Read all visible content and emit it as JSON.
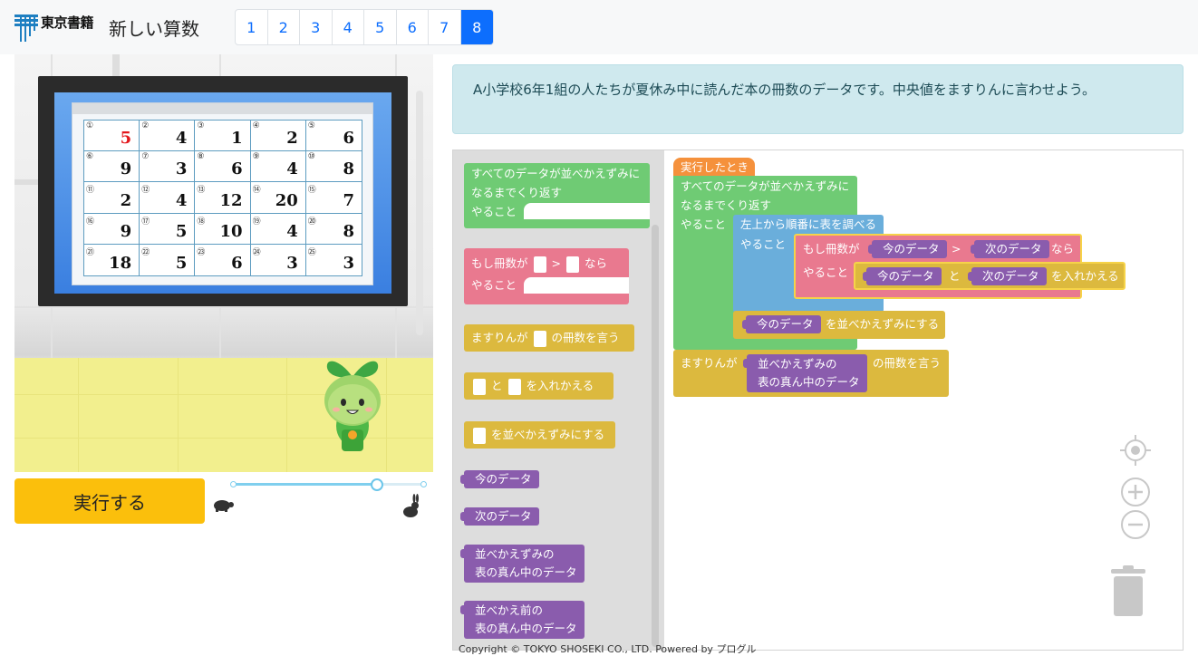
{
  "header": {
    "logo_text": "東京書籍",
    "title": "新しい算数",
    "pages": [
      "1",
      "2",
      "3",
      "4",
      "5",
      "6",
      "7",
      "8"
    ],
    "active_page": "8"
  },
  "board": {
    "cells": [
      {
        "i": "①",
        "v": "5",
        "red": true
      },
      {
        "i": "②",
        "v": "4"
      },
      {
        "i": "③",
        "v": "1"
      },
      {
        "i": "④",
        "v": "2"
      },
      {
        "i": "⑤",
        "v": "6"
      },
      {
        "i": "⑥",
        "v": "9"
      },
      {
        "i": "⑦",
        "v": "3"
      },
      {
        "i": "⑧",
        "v": "6"
      },
      {
        "i": "⑨",
        "v": "4"
      },
      {
        "i": "⑩",
        "v": "8"
      },
      {
        "i": "⑪",
        "v": "2"
      },
      {
        "i": "⑫",
        "v": "4"
      },
      {
        "i": "⑬",
        "v": "12"
      },
      {
        "i": "⑭",
        "v": "20"
      },
      {
        "i": "⑮",
        "v": "7"
      },
      {
        "i": "⑯",
        "v": "9"
      },
      {
        "i": "⑰",
        "v": "5"
      },
      {
        "i": "⑱",
        "v": "10"
      },
      {
        "i": "⑲",
        "v": "4"
      },
      {
        "i": "⑳",
        "v": "8"
      },
      {
        "i": "㉑",
        "v": "18"
      },
      {
        "i": "㉒",
        "v": "5"
      },
      {
        "i": "㉓",
        "v": "6"
      },
      {
        "i": "㉔",
        "v": "3"
      },
      {
        "i": "㉕",
        "v": "3"
      }
    ]
  },
  "controls": {
    "run_label": "実行する",
    "speed_value": 0.75
  },
  "task": {
    "text": "A小学校6年1組の人たちが夏休み中に読んだ本の冊数のデータです。中央値をますりんに言わせよう。"
  },
  "toolbox": {
    "repeat_l1": "すべてのデータが並べかえずみに",
    "repeat_l2": "なるまでくり返す",
    "repeat_do": "やること",
    "if_a": "もし冊数が",
    "if_op": ">",
    "if_b": "なら",
    "if_do": "やること",
    "say_a": "ますりんが",
    "say_b": "の冊数を言う",
    "swap_a": "と",
    "swap_b": "を入れかえる",
    "sort_b": "を並べかえずみにする",
    "v_current": "今のデータ",
    "v_next": "次のデータ",
    "v_sorted_l1": "並べかえずみの",
    "v_sorted_l2": "表の真ん中のデータ",
    "v_before_l1": "並べかえ前の",
    "v_before_l2": "表の真ん中のデータ"
  },
  "program": {
    "hat": "実行したとき",
    "repeat_l1": "すべてのデータが並べかえずみに",
    "repeat_l2": "なるまでくり返す",
    "repeat_do": "やること",
    "scan_l1": "左上から順番に表を調べる",
    "scan_do": "やること",
    "if_a": "もし冊数が",
    "if_x": "今のデータ",
    "if_op": ">",
    "if_y": "次のデータ",
    "if_b": "なら",
    "if_do": "やること",
    "swap_x": "今のデータ",
    "swap_and": "と",
    "swap_y": "次のデータ",
    "swap_b": "を入れかえる",
    "sort_x": "今のデータ",
    "sort_b": "を並べかえずみにする",
    "say_a": "ますりんが",
    "say_x1": "並べかえずみの",
    "say_x2": "表の真ん中のデータ",
    "say_b": "の冊数を言う"
  },
  "footer": {
    "copyright": "Copyright © TOKYO SHOSEKI CO., LTD. Powered by プログル"
  },
  "colors": {
    "accent": "#0d6efd",
    "run_button": "#fbbf0c",
    "loop_green": "#6fcb74",
    "logic_pink": "#e9798f",
    "action_yellow": "#dcb93e",
    "variable_purple": "#8a5cad",
    "scan_blue": "#6aaedb",
    "hat_orange": "#f5913c"
  }
}
